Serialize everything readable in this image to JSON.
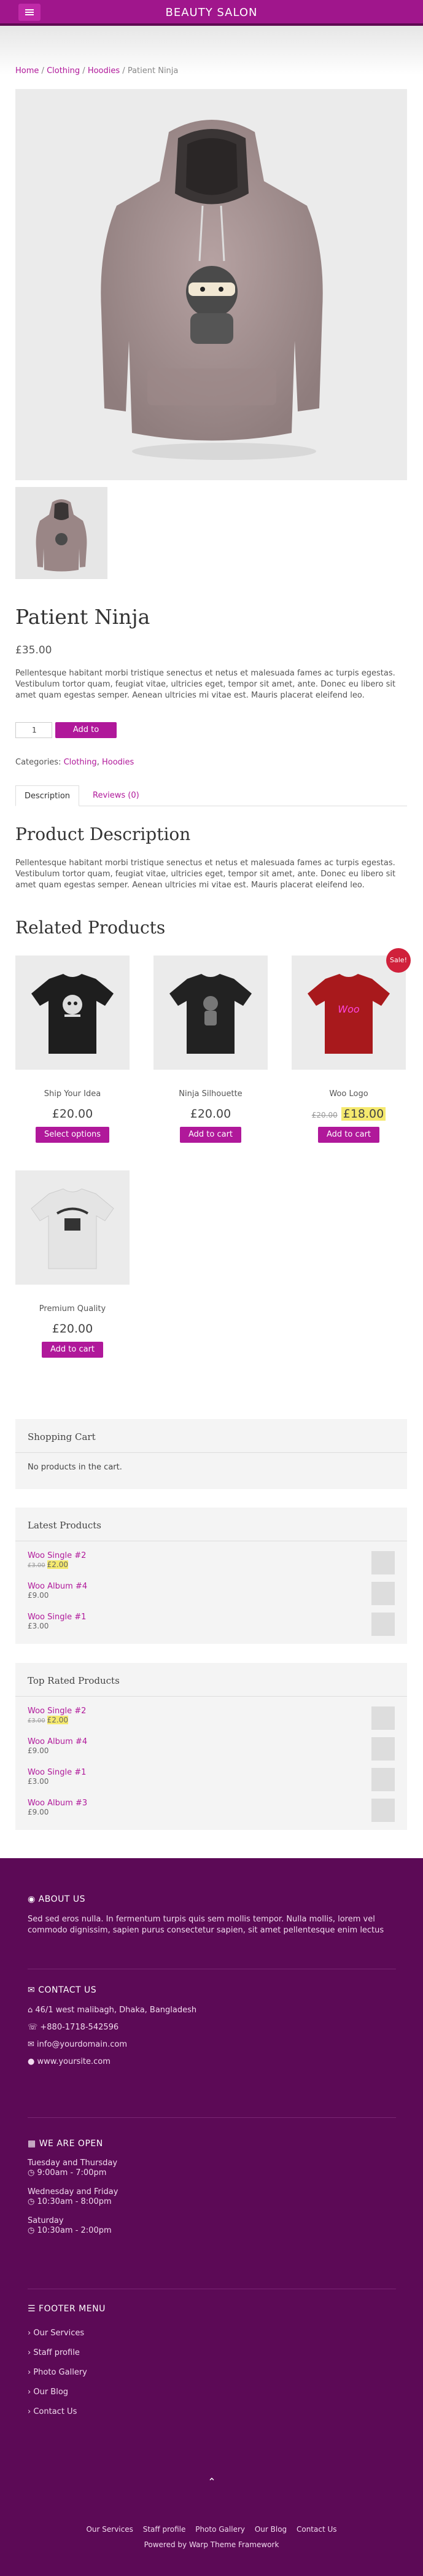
{
  "header": {
    "title": "BEAUTY SALON",
    "menu_icon": "menu-icon"
  },
  "breadcrumb": {
    "home": "Home",
    "clothing": "Clothing",
    "hoodies": "Hoodies",
    "current": "Patient Ninja",
    "sep": "/"
  },
  "product": {
    "title": "Patient Ninja",
    "price": "£35.00",
    "short_desc": "Pellentesque habitant morbi tristique senectus et netus et malesuada fames ac turpis egestas. Vestibulum tortor quam, feugiat vitae, ultricies eget, tempor sit amet, ante. Donec eu libero sit amet quam egestas semper. Aenean ultricies mi vitae est. Mauris placerat eleifend leo.",
    "qty": "1",
    "add_to_cart": "Add to cart",
    "categories_label": "Categories:",
    "cat1": "Clothing",
    "cat2": "Hoodies",
    "cat_sep": ","
  },
  "tabs": {
    "description": "Description",
    "reviews": "Reviews (0)"
  },
  "description": {
    "heading": "Product Description",
    "text": "Pellentesque habitant morbi tristique senectus et netus et malesuada fames ac turpis egestas. Vestibulum tortor quam, feugiat vitae, ultricies eget, tempor sit amet, ante. Donec eu libero sit amet quam egestas semper. Aenean ultricies mi vitae est. Mauris placerat eleifend leo."
  },
  "related": {
    "heading": "Related Products",
    "items": [
      {
        "name": "Ship Your Idea",
        "price": "£20.00",
        "button": "Select options"
      },
      {
        "name": "Ninja Silhouette",
        "price": "£20.00",
        "button": "Add to cart"
      },
      {
        "name": "Woo Logo",
        "old_price": "£20.00",
        "price": "£18.00",
        "button": "Add to cart",
        "badge": "Sale!",
        "print": "Woo"
      },
      {
        "name": "Premium Quality",
        "price": "£20.00",
        "button": "Add to cart"
      }
    ]
  },
  "cart_widget": {
    "title": "Shopping Cart",
    "empty": "No products in the cart."
  },
  "latest": {
    "title": "Latest Products",
    "items": [
      {
        "name": "Woo Single #2",
        "old": "£3.00",
        "price": "£2.00"
      },
      {
        "name": "Woo Album #4",
        "price": "£9.00"
      },
      {
        "name": "Woo Single #1",
        "price": "£3.00"
      }
    ]
  },
  "top_rated": {
    "title": "Top Rated Products",
    "items": [
      {
        "name": "Woo Single #2",
        "old": "£3.00",
        "price": "£2.00"
      },
      {
        "name": "Woo Album #4",
        "price": "£9.00"
      },
      {
        "name": "Woo Single #1",
        "price": "£3.00"
      },
      {
        "name": "Woo Album #3",
        "price": "£9.00"
      }
    ]
  },
  "footer": {
    "about": {
      "title": "ABOUT US",
      "text": "Sed sed eros nulla. In fermentum turpis quis sem mollis tempor. Nulla mollis, lorem vel commodo dignissim, sapien purus consectetur sapien, sit amet pellentesque enim lectus"
    },
    "contact": {
      "title": "CONTACT US",
      "address": "46/1 west malibagh, Dhaka, Bangladesh",
      "phone": "+880-1718-542596",
      "email": "info@yourdomain.com",
      "site": "www.yoursite.com"
    },
    "open": {
      "title": "WE ARE OPEN",
      "d1": "Tuesday and Thursday",
      "t1": "9:00am - 7:00pm",
      "d2": "Wednesday and Friday",
      "t2": "10:30am - 8:00pm",
      "d3": "Saturday",
      "t3": "10:30am - 2:00pm"
    },
    "menu": {
      "title": "FOOTER MENU",
      "items": [
        "Our Services",
        "Staff profile",
        "Photo Gallery",
        "Our Blog",
        "Contact Us"
      ]
    },
    "bottom_links": [
      "Our Services",
      "Staff profile",
      "Photo Gallery",
      "Our Blog",
      "Contact Us"
    ],
    "powered": "Powered by Warp Theme Framework",
    "totop_icon": "chevron-up-icon"
  }
}
